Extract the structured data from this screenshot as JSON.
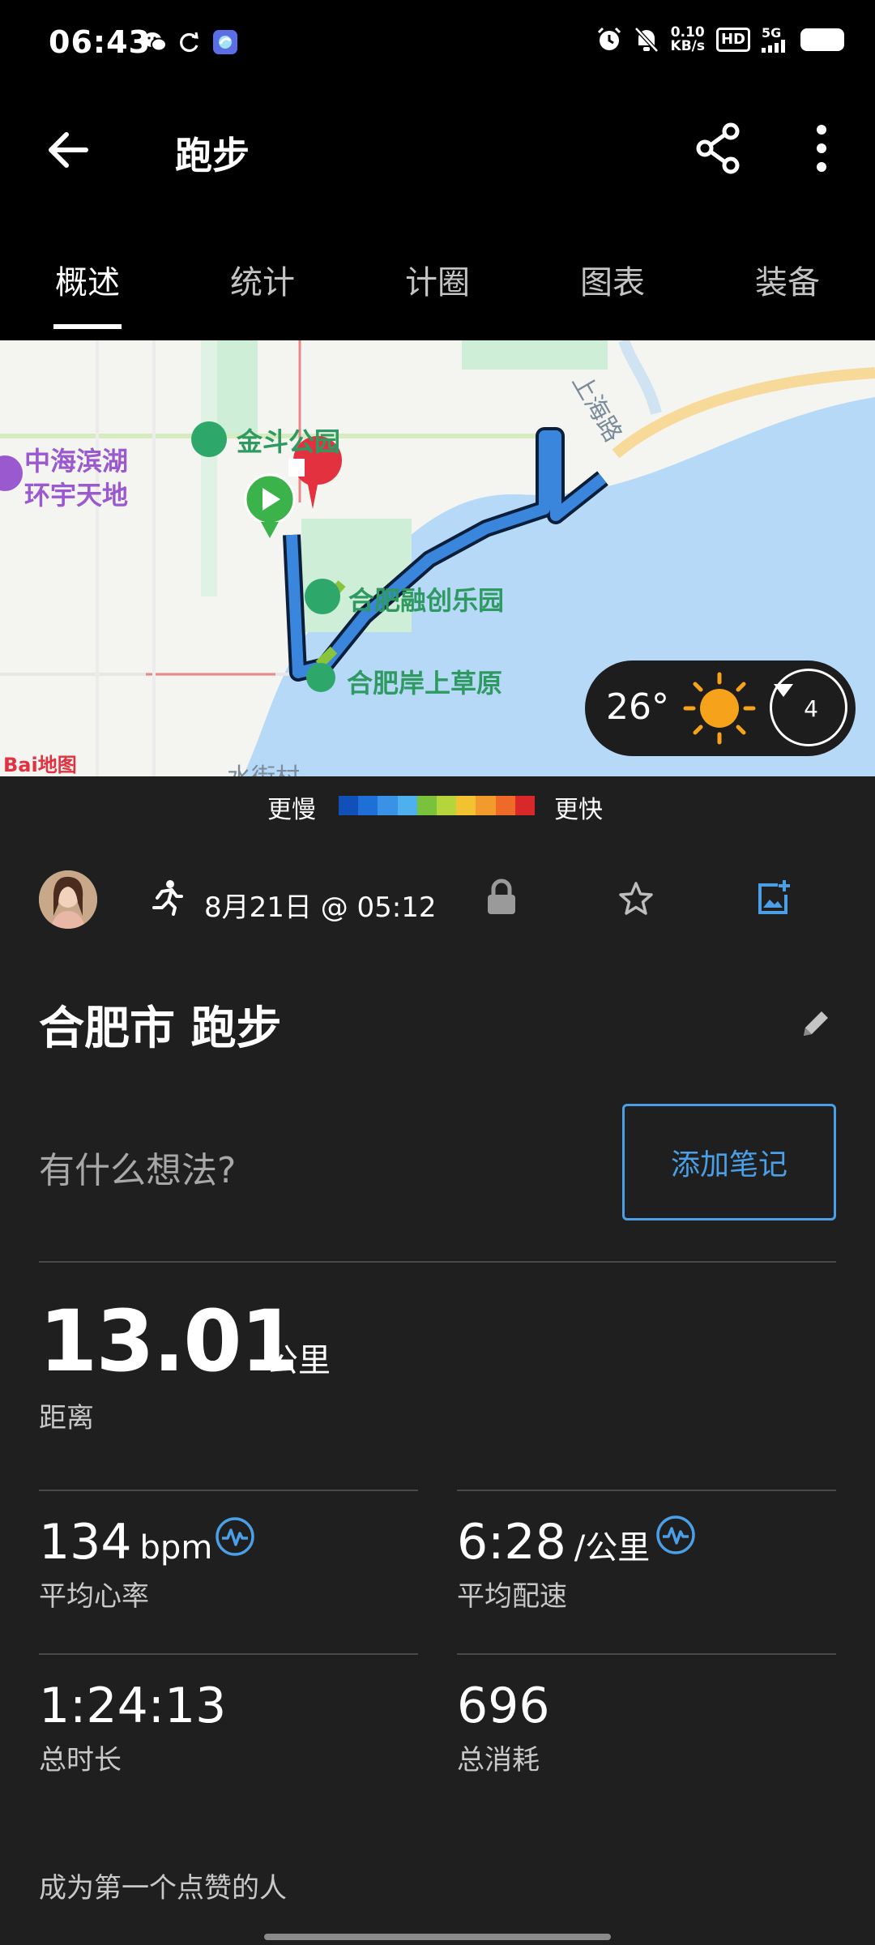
{
  "status_bar": {
    "time": "06:43",
    "net_speed_top": "0.10",
    "net_speed_bottom": "KB/s",
    "hd": "HD",
    "signal": "5G"
  },
  "app_bar": {
    "title": "跑步"
  },
  "tabs": [
    {
      "label": "概述",
      "active": true
    },
    {
      "label": "统计"
    },
    {
      "label": "计圈"
    },
    {
      "label": "图表"
    },
    {
      "label": "装备"
    }
  ],
  "map": {
    "labels": {
      "park": "金斗公园",
      "mall_line1": "中海滨湖",
      "mall_line2": "环宇天地",
      "sunac": "合肥融创乐园",
      "grassland": "合肥岸上草原",
      "road": "上海路",
      "village": "水街村",
      "logo": "Bai地图"
    },
    "weather": {
      "temperature": "26°",
      "lap_count": "4",
      "icon": "sun-icon"
    }
  },
  "pace_legend": {
    "slow": "更慢",
    "fast": "更快",
    "colors": [
      "#1150b8",
      "#1f6fd8",
      "#3a92e6",
      "#4fb0ee",
      "#79c23c",
      "#b6d43c",
      "#f2c230",
      "#f39a2c",
      "#ee6a28",
      "#d9282a"
    ]
  },
  "activity": {
    "date": "8月21日 @ 05:12",
    "title": "合肥市 跑步",
    "notes_prompt": "有什么想法?",
    "add_note_label": "添加笔记",
    "accent_color": "#4a9fe6"
  },
  "stats": {
    "distance": {
      "value": "13.01",
      "unit": "公里",
      "label": "距离"
    },
    "heart_rate": {
      "value": "134",
      "unit": "bpm",
      "label": "平均心率"
    },
    "pace": {
      "value": "6:28",
      "unit": "/公里",
      "label": "平均配速"
    },
    "duration": {
      "value": "1:24:13",
      "label": "总时长"
    },
    "calories": {
      "value": "696",
      "label": "总消耗"
    }
  },
  "social": {
    "like_prompt": "成为第一个点赞的人"
  }
}
